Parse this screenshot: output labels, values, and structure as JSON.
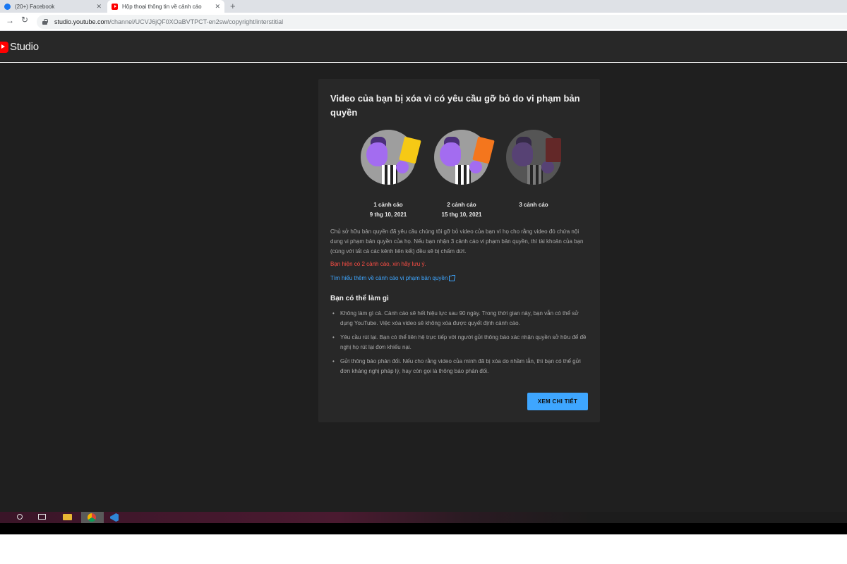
{
  "browser": {
    "tabs": [
      {
        "title": "(20+) Facebook",
        "close": "✕"
      },
      {
        "title": "Hộp thoại thông tin về cảnh cáo",
        "close": "✕"
      }
    ],
    "new_tab": "+",
    "url_host": "studio.youtube.com",
    "url_path": "/channel/UCVJ6jQF0XOaBVTPCT-en2sw/copyright/interstitial"
  },
  "studio": {
    "logo_text": "Studio"
  },
  "dialog": {
    "title": "Video của bạn bị xóa vì có yêu cầu gỡ bỏ do vi phạm bản quyền",
    "strikes": [
      {
        "label": "1 cảnh cáo",
        "date": "9 thg 10, 2021",
        "card_color": "#f6c915"
      },
      {
        "label": "2 cảnh cáo",
        "date": "15 thg 10, 2021",
        "card_color": "#f4761d"
      },
      {
        "label": "3 cảnh cáo",
        "date": "",
        "card_color": "#c42a2a"
      }
    ],
    "body": "Chủ sở hữu bản quyền đã yêu cầu chúng tôi gỡ bỏ video của bạn vì họ cho rằng video đó chứa nội dung vi phạm bản quyền của họ. Nếu bạn nhận 3 cảnh cáo vi phạm bản quyền, thì tài khoản của bạn (cùng với tất cả các kênh liên kết) đều sẽ bị chấm dứt.",
    "warning": "Bạn hiện có 2 cảnh cáo, xin hãy lưu ý.",
    "learn_more": "Tìm hiểu thêm về cảnh cáo vi phạm bản quyền",
    "section_title": "Bạn có thể làm gì",
    "options": [
      "Không làm gì cả. Cảnh cáo sẽ hết hiệu lực sau 90 ngày. Trong thời gian này, bạn vẫn có thể sử dụng YouTube. Việc xóa video sẽ không xóa được quyết định cảnh cáo.",
      "Yêu cầu rút lại. Bạn có thể liên hệ trực tiếp với người gửi thông báo xác nhận quyền sở hữu để đề nghị họ rút lại đơn khiếu nại.",
      "Gửi thông báo phản đối. Nếu cho rằng video của mình đã bị xóa do nhầm lẫn, thì bạn có thể gửi đơn kháng nghị pháp lý, hay còn gọi là thông báo phản đối."
    ],
    "button": "XEM CHI TIẾT"
  },
  "colors": {
    "accent_blue": "#3ea6ff",
    "warning_red": "#ff4e45",
    "dialog_bg": "#282828",
    "page_bg": "#1f1f1f"
  },
  "icons": {
    "back": "arrow-right-icon",
    "reload": "reload-icon",
    "lock": "lock-icon",
    "external": "external-link-icon"
  }
}
